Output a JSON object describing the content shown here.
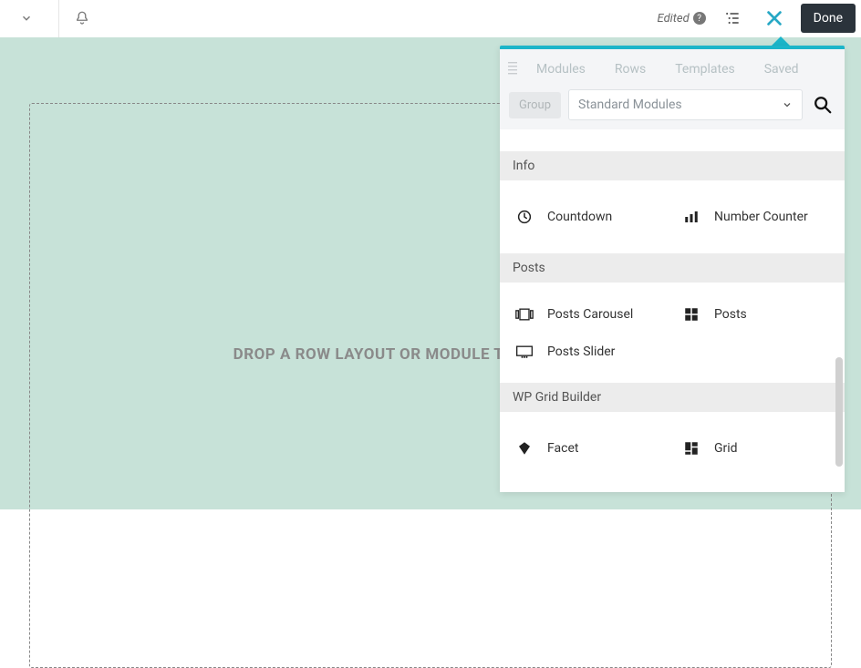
{
  "topbar": {
    "edited_label": "Edited",
    "done_label": "Done"
  },
  "dropzone": {
    "text": "DROP A ROW LAYOUT OR MODULE TO GET STARTED!"
  },
  "panel": {
    "tabs": {
      "modules": "Modules",
      "rows": "Rows",
      "templates": "Templates",
      "saved": "Saved"
    },
    "filter": {
      "group_label": "Group",
      "selected": "Standard Modules"
    },
    "sections": [
      {
        "title": "Info",
        "items": [
          {
            "label": "Countdown"
          },
          {
            "label": "Number Counter"
          }
        ]
      },
      {
        "title": "Posts",
        "items": [
          {
            "label": "Posts Carousel"
          },
          {
            "label": "Posts"
          },
          {
            "label": "Posts Slider"
          }
        ]
      },
      {
        "title": "WP Grid Builder",
        "items": [
          {
            "label": "Facet"
          },
          {
            "label": "Grid"
          }
        ]
      }
    ]
  }
}
